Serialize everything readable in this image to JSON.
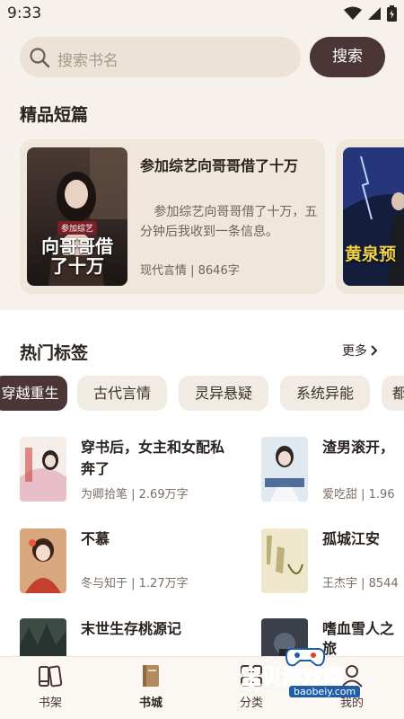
{
  "status": {
    "time": "9:33"
  },
  "search": {
    "placeholder": "搜索书名",
    "button_label": "搜索"
  },
  "featured": {
    "title": "精品短篇",
    "book": {
      "title": "参加综艺向哥哥借了十万",
      "description": "参加综艺向哥哥借了十万，五分钟后我收到一条信息。",
      "meta": "现代言情 | 8646字",
      "cover_text_small": "参加综艺",
      "cover_text_big": "向哥哥借了十万"
    },
    "book2_cover_text": "黄泉预"
  },
  "hot_tags": {
    "title": "热门标签",
    "more_label": "更多",
    "tags": [
      "穿越重生",
      "古代言情",
      "灵异悬疑",
      "系统异能",
      "都"
    ]
  },
  "books": [
    {
      "title_line1": "穿书后，女主和女配私",
      "title_line2": "奔了",
      "meta": "为卿拾笔 | 2.69万字"
    },
    {
      "title_line1": "渣男滚开，",
      "title_line2": "",
      "meta": "爱吃甜 | 1.96"
    },
    {
      "title_line1": "不慕",
      "title_line2": "",
      "meta": "冬与知于 | 1.27万字"
    },
    {
      "title_line1": "孤城江安",
      "title_line2": "",
      "meta": "王杰宇 | 8544"
    },
    {
      "title_line1": "末世生存桃源记",
      "title_line2": "",
      "meta": ""
    },
    {
      "title_line1": "嗜血雪人之",
      "title_line2": "旅",
      "meta": ""
    }
  ],
  "bottom_nav": {
    "items": [
      {
        "label": "书架",
        "icon": "bookshelf-icon"
      },
      {
        "label": "书城",
        "icon": "book-icon",
        "active": true
      },
      {
        "label": "分类",
        "icon": "category-icon"
      },
      {
        "label": "我的",
        "icon": "profile-icon"
      }
    ]
  },
  "watermark": {
    "text": "宝贝游戏网",
    "url": "baobeiy.com"
  },
  "colors": {
    "accent": "#4b3536",
    "background": "#f6f1ea"
  }
}
